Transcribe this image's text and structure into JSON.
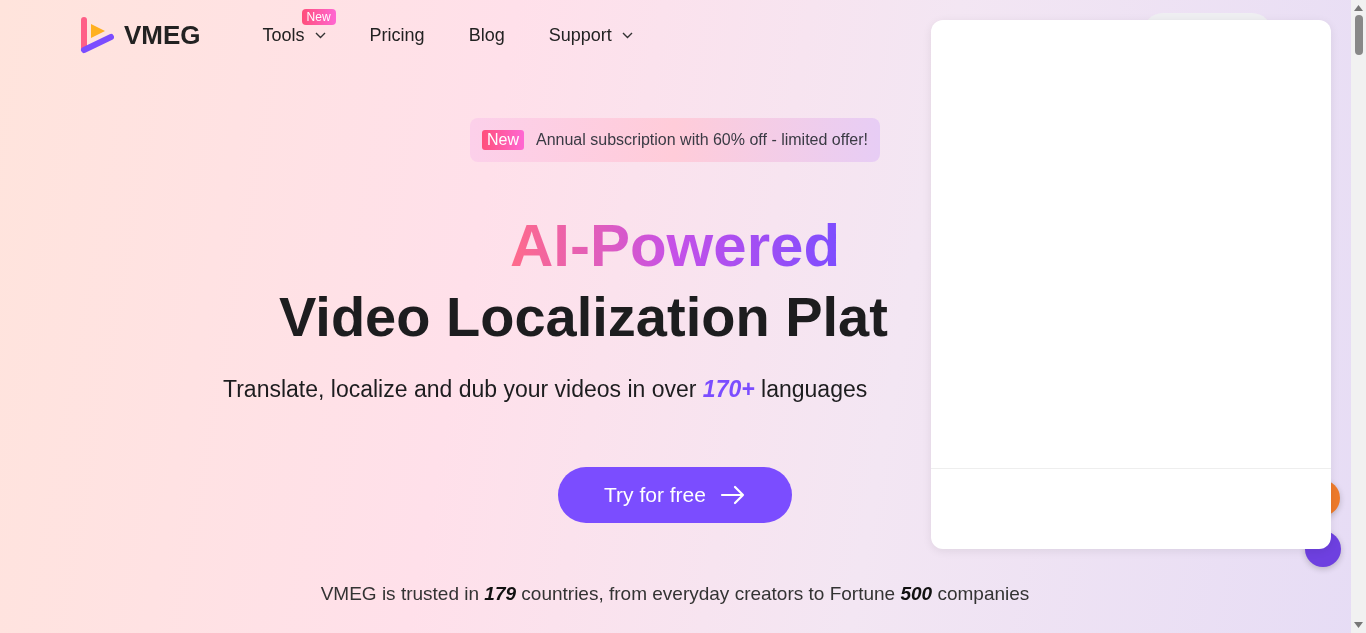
{
  "nav": {
    "logo": "VMEG",
    "items": [
      {
        "label": "Tools",
        "badge": "New",
        "dropdown": true
      },
      {
        "label": "Pricing",
        "dropdown": false
      },
      {
        "label": "Blog",
        "dropdown": false
      },
      {
        "label": "Support",
        "dropdown": true
      }
    ]
  },
  "promo": {
    "badge": "New",
    "text": "Annual subscription with 60% off - limited offer!"
  },
  "hero": {
    "title_accent": "AI-Powered",
    "title_main": "Video Localization Plat",
    "subtitle": {
      "before": "Translate, localize and dub your videos in over ",
      "highlight": "170+",
      "after": " languages"
    },
    "cta": "Try for free",
    "trust": [
      {
        "text": "VMEG is trusted in ",
        "strong": false
      },
      {
        "text": "179",
        "strong": true
      },
      {
        "text": " countries, from everyday creators to Fortune ",
        "strong": false
      },
      {
        "text": "500",
        "strong": true
      },
      {
        "text": " companies",
        "strong": false
      }
    ]
  }
}
